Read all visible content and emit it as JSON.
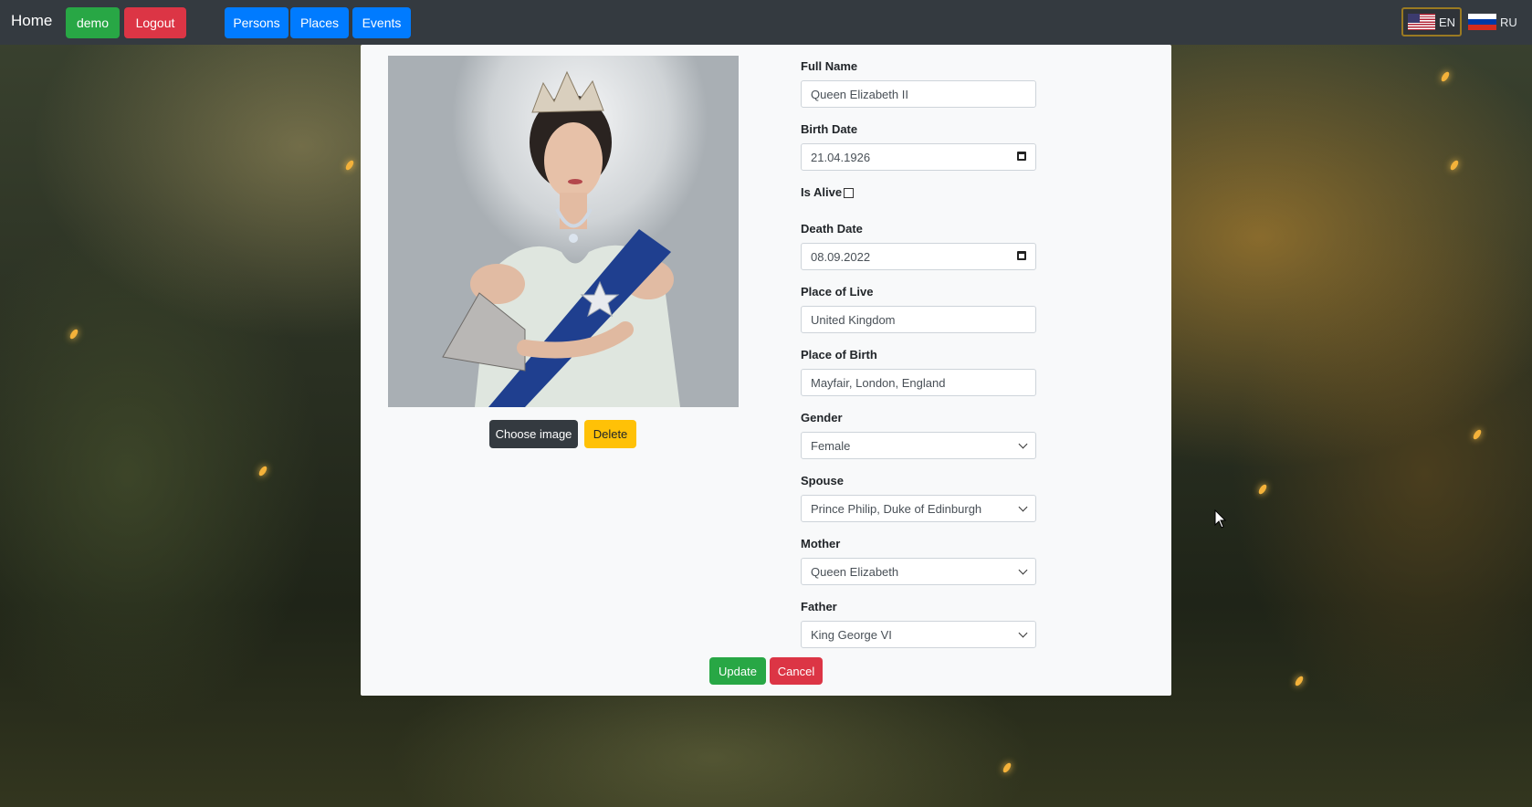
{
  "navbar": {
    "home": "Home",
    "user": "demo",
    "logout": "Logout",
    "persons": "Persons",
    "places": "Places",
    "events": "Events",
    "languages": [
      {
        "code": "EN",
        "active": true
      },
      {
        "code": "RU",
        "active": false
      }
    ]
  },
  "photo_actions": {
    "choose_image": "Choose image",
    "delete": "Delete"
  },
  "form": {
    "full_name_label": "Full Name",
    "full_name_value": "Queen Elizabeth II",
    "birth_date_label": "Birth Date",
    "birth_date_value": "21.04.1926",
    "is_alive_label": "Is Alive",
    "is_alive_checked": false,
    "death_date_label": "Death Date",
    "death_date_value": "08.09.2022",
    "place_of_live_label": "Place of Live",
    "place_of_live_value": "United Kingdom",
    "place_of_birth_label": "Place of Birth",
    "place_of_birth_value": "Mayfair, London, England",
    "gender_label": "Gender",
    "gender_value": "Female",
    "spouse_label": "Spouse",
    "spouse_value": "Prince Philip, Duke of Edinburgh",
    "mother_label": "Mother",
    "mother_value": "Queen Elizabeth",
    "father_label": "Father",
    "father_value": "King George VI"
  },
  "actions": {
    "update": "Update",
    "cancel": "Cancel"
  },
  "colors": {
    "navbar": "#343a40",
    "success": "#28a745",
    "danger": "#dc3545",
    "primary": "#007bff",
    "warning": "#ffc107",
    "dark": "#343a40"
  }
}
